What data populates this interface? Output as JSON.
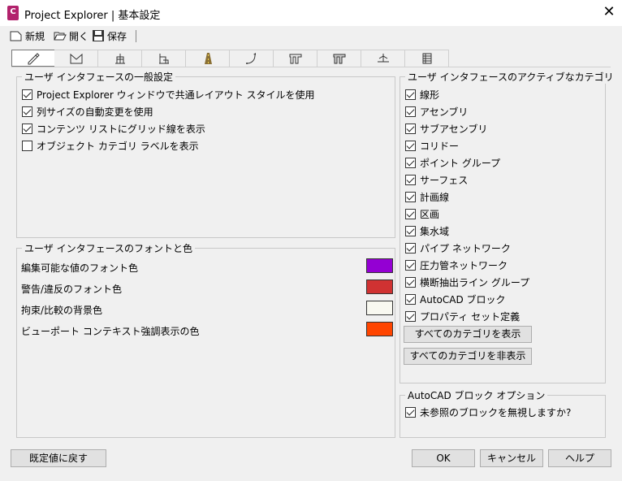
{
  "window": {
    "app_icon_letter": "C",
    "title": "Project Explorer | 基本設定",
    "close_glyph": "✕"
  },
  "toolbar": {
    "new_label": "新規",
    "open_label": "開く",
    "save_label": "保存"
  },
  "tabs": [
    {
      "icon": "pencil-icon"
    },
    {
      "icon": "surface-icon"
    },
    {
      "icon": "alignment-icon"
    },
    {
      "icon": "profile-icon"
    },
    {
      "icon": "road-icon"
    },
    {
      "icon": "curve-icon"
    },
    {
      "icon": "pipe-network-icon"
    },
    {
      "icon": "pressure-network-icon"
    },
    {
      "icon": "section-icon"
    },
    {
      "icon": "table-icon"
    }
  ],
  "general": {
    "title": "ユーザ インタフェースの一般設定",
    "items": [
      {
        "label": "Project Explorer ウィンドウで共通レイアウト スタイルを使用",
        "checked": true
      },
      {
        "label": "列サイズの自動変更を使用",
        "checked": true
      },
      {
        "label": "コンテンツ リストにグリッド線を表示",
        "checked": true
      },
      {
        "label": "オブジェクト カテゴリ ラベルを表示",
        "checked": false
      }
    ]
  },
  "fonts": {
    "title": "ユーザ インタフェースのフォントと色",
    "items": [
      {
        "label": "編集可能な値のフォント色",
        "color": "#9400d3"
      },
      {
        "label": "警告/違反のフォント色",
        "color": "#d03232"
      },
      {
        "label": "拘束/比較の背景色",
        "color": "#f8f8f0"
      },
      {
        "label": "ビューポート コンテキスト強調表示の色",
        "color": "#ff4500"
      }
    ]
  },
  "categories": {
    "title": "ユーザ インタフェースのアクティブなカテゴリ",
    "items": [
      {
        "label": "線形",
        "checked": true
      },
      {
        "label": "アセンブリ",
        "checked": true
      },
      {
        "label": "サブアセンブリ",
        "checked": true
      },
      {
        "label": "コリドー",
        "checked": true
      },
      {
        "label": "ポイント グループ",
        "checked": true
      },
      {
        "label": "サーフェス",
        "checked": true
      },
      {
        "label": "計画線",
        "checked": true
      },
      {
        "label": "区画",
        "checked": true
      },
      {
        "label": "集水域",
        "checked": true
      },
      {
        "label": "パイプ ネットワーク",
        "checked": true
      },
      {
        "label": "圧力管ネットワーク",
        "checked": true
      },
      {
        "label": "横断抽出ライン グループ",
        "checked": true
      },
      {
        "label": "AutoCAD ブロック",
        "checked": true
      },
      {
        "label": "プロパティ セット定義",
        "checked": true
      }
    ],
    "show_all_label": "すべてのカテゴリを表示",
    "hide_all_label": "すべてのカテゴリを非表示"
  },
  "block_options": {
    "title": "AutoCAD ブロック オプション",
    "item": {
      "label": "未参照のブロックを無視しますか?",
      "checked": true
    }
  },
  "footer": {
    "reset_label": "既定値に戻す",
    "ok_label": "OK",
    "cancel_label": "キャンセル",
    "help_label": "ヘルプ"
  }
}
